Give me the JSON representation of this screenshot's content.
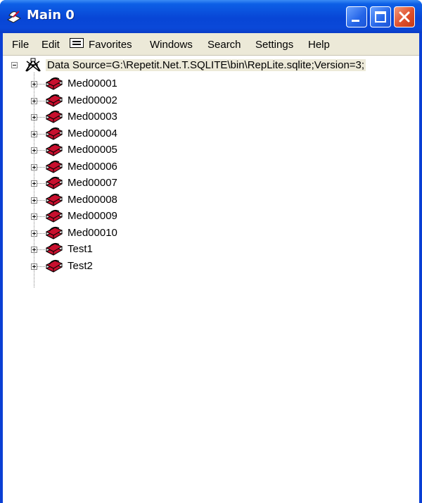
{
  "window": {
    "title": "Main 0",
    "buttons": {
      "minimize": "minimize",
      "maximize": "maximize",
      "close": "close"
    }
  },
  "menu": [
    {
      "label": "File"
    },
    {
      "label": "Edit"
    },
    {
      "label": "Favorites",
      "icon": "favorites-icon"
    },
    {
      "label": "Windows"
    },
    {
      "label": "Search"
    },
    {
      "label": "Settings"
    },
    {
      "label": "Help"
    }
  ],
  "tree": {
    "root": {
      "label": "Data Source=G:\\Repetit.Net.T.SQLITE\\bin\\RepLite.sqlite;Version=3;",
      "icon": "connection-icon",
      "expanded": true
    },
    "children": [
      {
        "label": "Med00001",
        "icon": "database-icon"
      },
      {
        "label": "Med00002",
        "icon": "database-icon"
      },
      {
        "label": "Med00003",
        "icon": "database-icon"
      },
      {
        "label": "Med00004",
        "icon": "database-icon"
      },
      {
        "label": "Med00005",
        "icon": "database-icon"
      },
      {
        "label": "Med00006",
        "icon": "database-icon"
      },
      {
        "label": "Med00007",
        "icon": "database-icon"
      },
      {
        "label": "Med00008",
        "icon": "database-icon"
      },
      {
        "label": "Med00009",
        "icon": "database-icon"
      },
      {
        "label": "Med00010",
        "icon": "database-icon"
      },
      {
        "label": "Test1",
        "icon": "database-icon"
      },
      {
        "label": "Test2",
        "icon": "database-icon"
      }
    ]
  },
  "colors": {
    "titlebar": "#0846d6",
    "menubar": "#ece9d8",
    "close_button": "#e0502c",
    "db_icon": "#c8102e"
  }
}
